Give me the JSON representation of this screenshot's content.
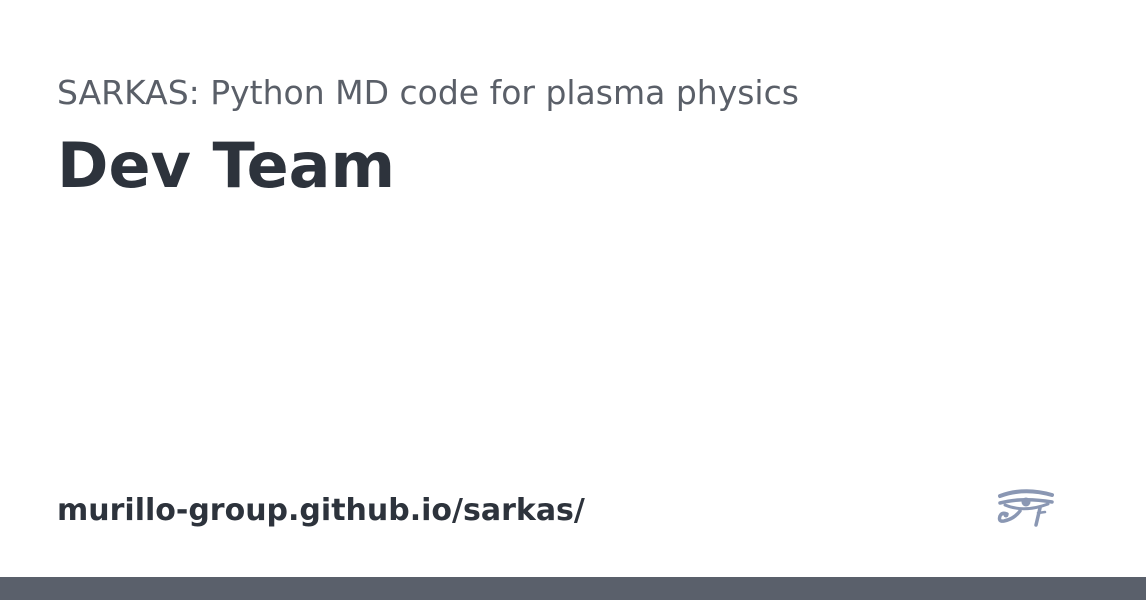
{
  "site": {
    "title": "SARKAS: Python MD code for plasma physics",
    "url": "murillo-group.github.io/sarkas/"
  },
  "page": {
    "title": "Dev Team"
  },
  "logo": {
    "icon": "eye-of-horus-icon",
    "color": "#8a97b3"
  },
  "theme": {
    "bar_color": "#5a606b"
  }
}
